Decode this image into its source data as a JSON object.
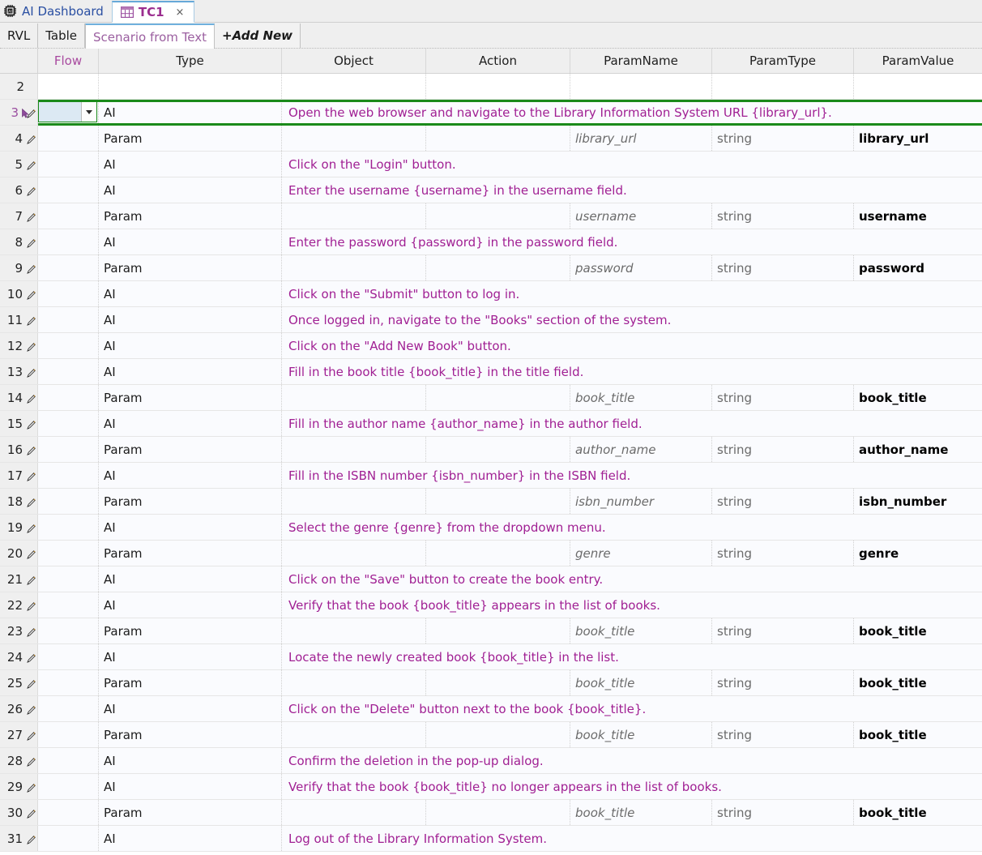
{
  "window": {
    "home_tab": {
      "label": "AI Dashboard",
      "icon": "ai-chip-icon"
    },
    "doc_tab": {
      "label": "TC1",
      "icon": "table-grid-icon",
      "close": "×"
    }
  },
  "subtabs": [
    {
      "label": "RVL"
    },
    {
      "label": "Table"
    },
    {
      "label": "Scenario from Text"
    },
    {
      "label": "+Add New"
    }
  ],
  "grid": {
    "columns": [
      "Flow",
      "Type",
      "Object",
      "Action",
      "ParamName",
      "ParamType",
      "ParamValue"
    ],
    "selected_row": 3,
    "selected_cell": {
      "column": "Flow",
      "value": "",
      "control": "dropdown"
    },
    "rows": [
      {
        "n": "2",
        "kind": "blank",
        "flow": "",
        "type": "",
        "object": "",
        "action": "",
        "pname": "",
        "ptype": "",
        "pvalue": ""
      },
      {
        "n": "3",
        "kind": "ai",
        "flow": "",
        "type": "AI",
        "text": "Open the web browser and navigate to the Library Information System URL {library_url}."
      },
      {
        "n": "4",
        "kind": "param",
        "flow": "",
        "type": "Param",
        "object": "",
        "action": "",
        "pname": "library_url",
        "ptype": "string",
        "pvalue": "library_url"
      },
      {
        "n": "5",
        "kind": "ai",
        "flow": "",
        "type": "AI",
        "text": "Click on the \"Login\" button."
      },
      {
        "n": "6",
        "kind": "ai",
        "flow": "",
        "type": "AI",
        "text": "Enter the username {username} in the username field."
      },
      {
        "n": "7",
        "kind": "param",
        "flow": "",
        "type": "Param",
        "object": "",
        "action": "",
        "pname": "username",
        "ptype": "string",
        "pvalue": "username"
      },
      {
        "n": "8",
        "kind": "ai",
        "flow": "",
        "type": "AI",
        "text": "Enter the password {password} in the password field."
      },
      {
        "n": "9",
        "kind": "param",
        "flow": "",
        "type": "Param",
        "object": "",
        "action": "",
        "pname": "password",
        "ptype": "string",
        "pvalue": "password"
      },
      {
        "n": "10",
        "kind": "ai",
        "flow": "",
        "type": "AI",
        "text": "Click on the \"Submit\" button to log in."
      },
      {
        "n": "11",
        "kind": "ai",
        "flow": "",
        "type": "AI",
        "text": "Once logged in, navigate to the \"Books\" section of the system."
      },
      {
        "n": "12",
        "kind": "ai",
        "flow": "",
        "type": "AI",
        "text": "Click on the \"Add New Book\" button."
      },
      {
        "n": "13",
        "kind": "ai",
        "flow": "",
        "type": "AI",
        "text": "Fill in the book title {book_title} in the title field."
      },
      {
        "n": "14",
        "kind": "param",
        "flow": "",
        "type": "Param",
        "object": "",
        "action": "",
        "pname": "book_title",
        "ptype": "string",
        "pvalue": "book_title"
      },
      {
        "n": "15",
        "kind": "ai",
        "flow": "",
        "type": "AI",
        "text": "Fill in the author name {author_name} in the author field."
      },
      {
        "n": "16",
        "kind": "param",
        "flow": "",
        "type": "Param",
        "object": "",
        "action": "",
        "pname": "author_name",
        "ptype": "string",
        "pvalue": "author_name"
      },
      {
        "n": "17",
        "kind": "ai",
        "flow": "",
        "type": "AI",
        "text": "Fill in the ISBN number {isbn_number} in the ISBN field."
      },
      {
        "n": "18",
        "kind": "param",
        "flow": "",
        "type": "Param",
        "object": "",
        "action": "",
        "pname": "isbn_number",
        "ptype": "string",
        "pvalue": "isbn_number"
      },
      {
        "n": "19",
        "kind": "ai",
        "flow": "",
        "type": "AI",
        "text": "Select the genre {genre} from the dropdown menu."
      },
      {
        "n": "20",
        "kind": "param",
        "flow": "",
        "type": "Param",
        "object": "",
        "action": "",
        "pname": "genre",
        "ptype": "string",
        "pvalue": "genre"
      },
      {
        "n": "21",
        "kind": "ai",
        "flow": "",
        "type": "AI",
        "text": "Click on the \"Save\" button to create the book entry."
      },
      {
        "n": "22",
        "kind": "ai",
        "flow": "",
        "type": "AI",
        "text": "Verify that the book {book_title} appears in the list of books."
      },
      {
        "n": "23",
        "kind": "param",
        "flow": "",
        "type": "Param",
        "object": "",
        "action": "",
        "pname": "book_title",
        "ptype": "string",
        "pvalue": "book_title"
      },
      {
        "n": "24",
        "kind": "ai",
        "flow": "",
        "type": "AI",
        "text": "Locate the newly created book {book_title} in the list."
      },
      {
        "n": "25",
        "kind": "param",
        "flow": "",
        "type": "Param",
        "object": "",
        "action": "",
        "pname": "book_title",
        "ptype": "string",
        "pvalue": "book_title"
      },
      {
        "n": "26",
        "kind": "ai",
        "flow": "",
        "type": "AI",
        "text": "Click on the \"Delete\" button next to the book {book_title}."
      },
      {
        "n": "27",
        "kind": "param",
        "flow": "",
        "type": "Param",
        "object": "",
        "action": "",
        "pname": "book_title",
        "ptype": "string",
        "pvalue": "book_title"
      },
      {
        "n": "28",
        "kind": "ai",
        "flow": "",
        "type": "AI",
        "text": "Confirm the deletion in the pop-up dialog."
      },
      {
        "n": "29",
        "kind": "ai",
        "flow": "",
        "type": "AI",
        "text": "Verify that the book {book_title} no longer appears in the list of books."
      },
      {
        "n": "30",
        "kind": "param",
        "flow": "",
        "type": "Param",
        "object": "",
        "action": "",
        "pname": "book_title",
        "ptype": "string",
        "pvalue": "book_title"
      },
      {
        "n": "31",
        "kind": "ai",
        "flow": "",
        "type": "AI",
        "text": "Log out of the Library Information System."
      }
    ]
  },
  "colors": {
    "ai_text": "#a01f93",
    "selection_outline": "#1a8a1a",
    "header_flow": "#a8499f",
    "active_tab": "#9b2d8f",
    "home_tab": "#2a4fa2"
  }
}
